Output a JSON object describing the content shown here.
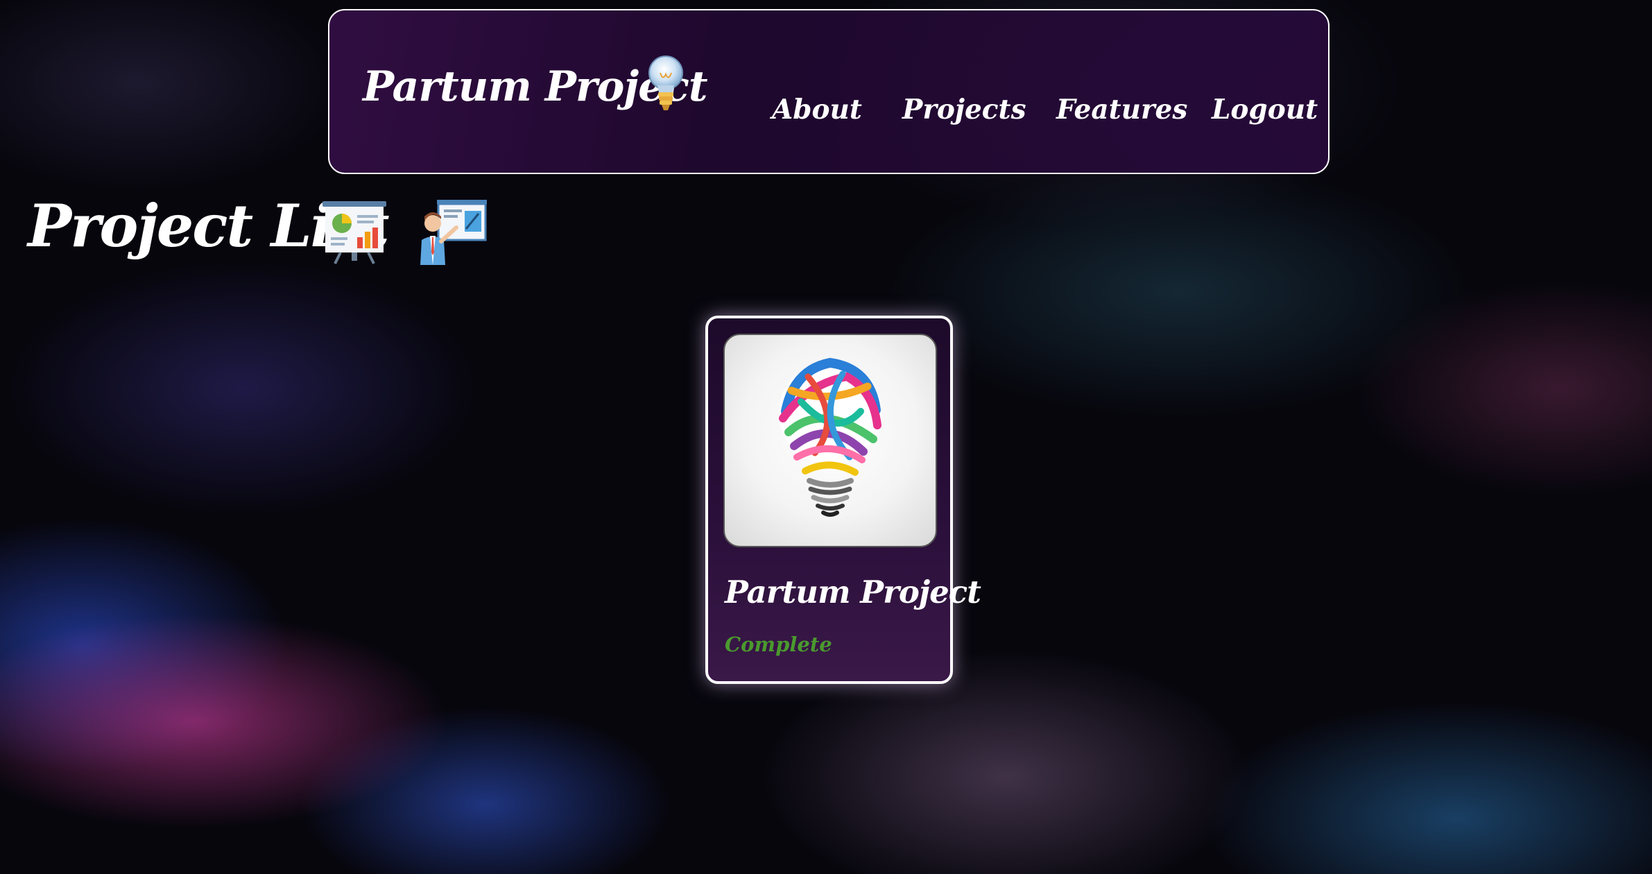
{
  "navbar": {
    "brand": "Partum Project",
    "brand_icon": "lightbulb-icon",
    "links": [
      {
        "label": "About"
      },
      {
        "label": "Projects"
      },
      {
        "label": "Features"
      },
      {
        "label": "Logout"
      }
    ]
  },
  "page": {
    "title": "Project List",
    "title_icons": [
      "chart-presentation-icon",
      "presenter-icon"
    ]
  },
  "projects": [
    {
      "title": "Partum Project",
      "status": "Complete",
      "image": "colorful-lightbulb-image"
    }
  ],
  "colors": {
    "navbar_bg": "#2a0b3c",
    "card_bg": "#230c32",
    "status_complete": "#4a9a2e",
    "text": "#ffffff",
    "border": "#ffffff"
  }
}
